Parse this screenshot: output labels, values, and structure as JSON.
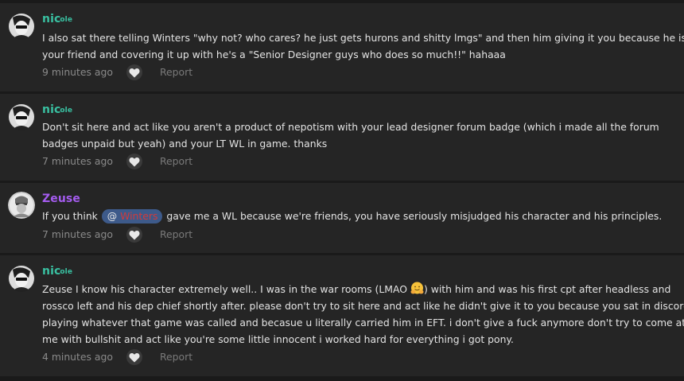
{
  "colors": {
    "page_bg": "#1a1a1a",
    "post_bg": "#252525",
    "username_teal": "#39c0a1",
    "username_purple": "#a55cf0",
    "mention_bg": "#3d5a8a",
    "mention_name": "#d23a3a",
    "muted_text": "#8a8a8a"
  },
  "posts": [
    {
      "author": "nicole",
      "author_prefix": "nic",
      "author_decor": "ole",
      "avatar_icon": "avatar-dark-portrait-icon",
      "message_lines": [
        "I also sat there telling Winters \"why not? who cares? he just gets hurons and shitty lmgs\" and then him giving it you because he is",
        "your friend and covering it up with he's a \"Senior Designer guys who does so much!!\" hahaaa"
      ],
      "time": "9 minutes ago",
      "like_icon": "heart-icon",
      "report_label": "Report"
    },
    {
      "author": "nicole",
      "author_prefix": "nic",
      "author_decor": "ole",
      "avatar_icon": "avatar-dark-portrait-icon",
      "message_lines": [
        "Don't sit here and act like you aren't a product of nepotism with your lead designer forum badge (which i made all the forum",
        "badges unpaid but yeah) and your LT WL in game. thanks"
      ],
      "time": "7 minutes ago",
      "like_icon": "heart-icon",
      "report_label": "Report"
    },
    {
      "author": "Zeuse",
      "avatar_icon": "avatar-gray-portrait-icon",
      "message_before": "If you think ",
      "mention_at": "@",
      "mention_name": "Winters",
      "message_after": " gave me a WL because we're friends, you have seriously misjudged his character and his principles.",
      "time": "7 minutes ago",
      "like_icon": "heart-icon",
      "report_label": "Report"
    },
    {
      "author": "nicole",
      "author_prefix": "nic",
      "author_decor": "ole",
      "avatar_icon": "avatar-dark-portrait-icon",
      "line1_before": "Zeuse I know his character extremely well.. I was in the war rooms (LMAO ",
      "emoji_icon": "hugging-face-emoji-icon",
      "line1_after": ") with him and was his first cpt after headless and",
      "message_lines": [
        "rossco left and his dep chief shortly after. please don't try to sit here and act like he didn't give it to you because you sat in discord",
        "playing whatever that game was called and becasue u literally carried him in EFT. i don't give a fuck anymore don't try to come at",
        "me with bullshit and act like you're some little innocent i worked hard for everything i got pony."
      ],
      "time": "4 minutes ago",
      "like_icon": "heart-icon",
      "report_label": "Report"
    }
  ]
}
